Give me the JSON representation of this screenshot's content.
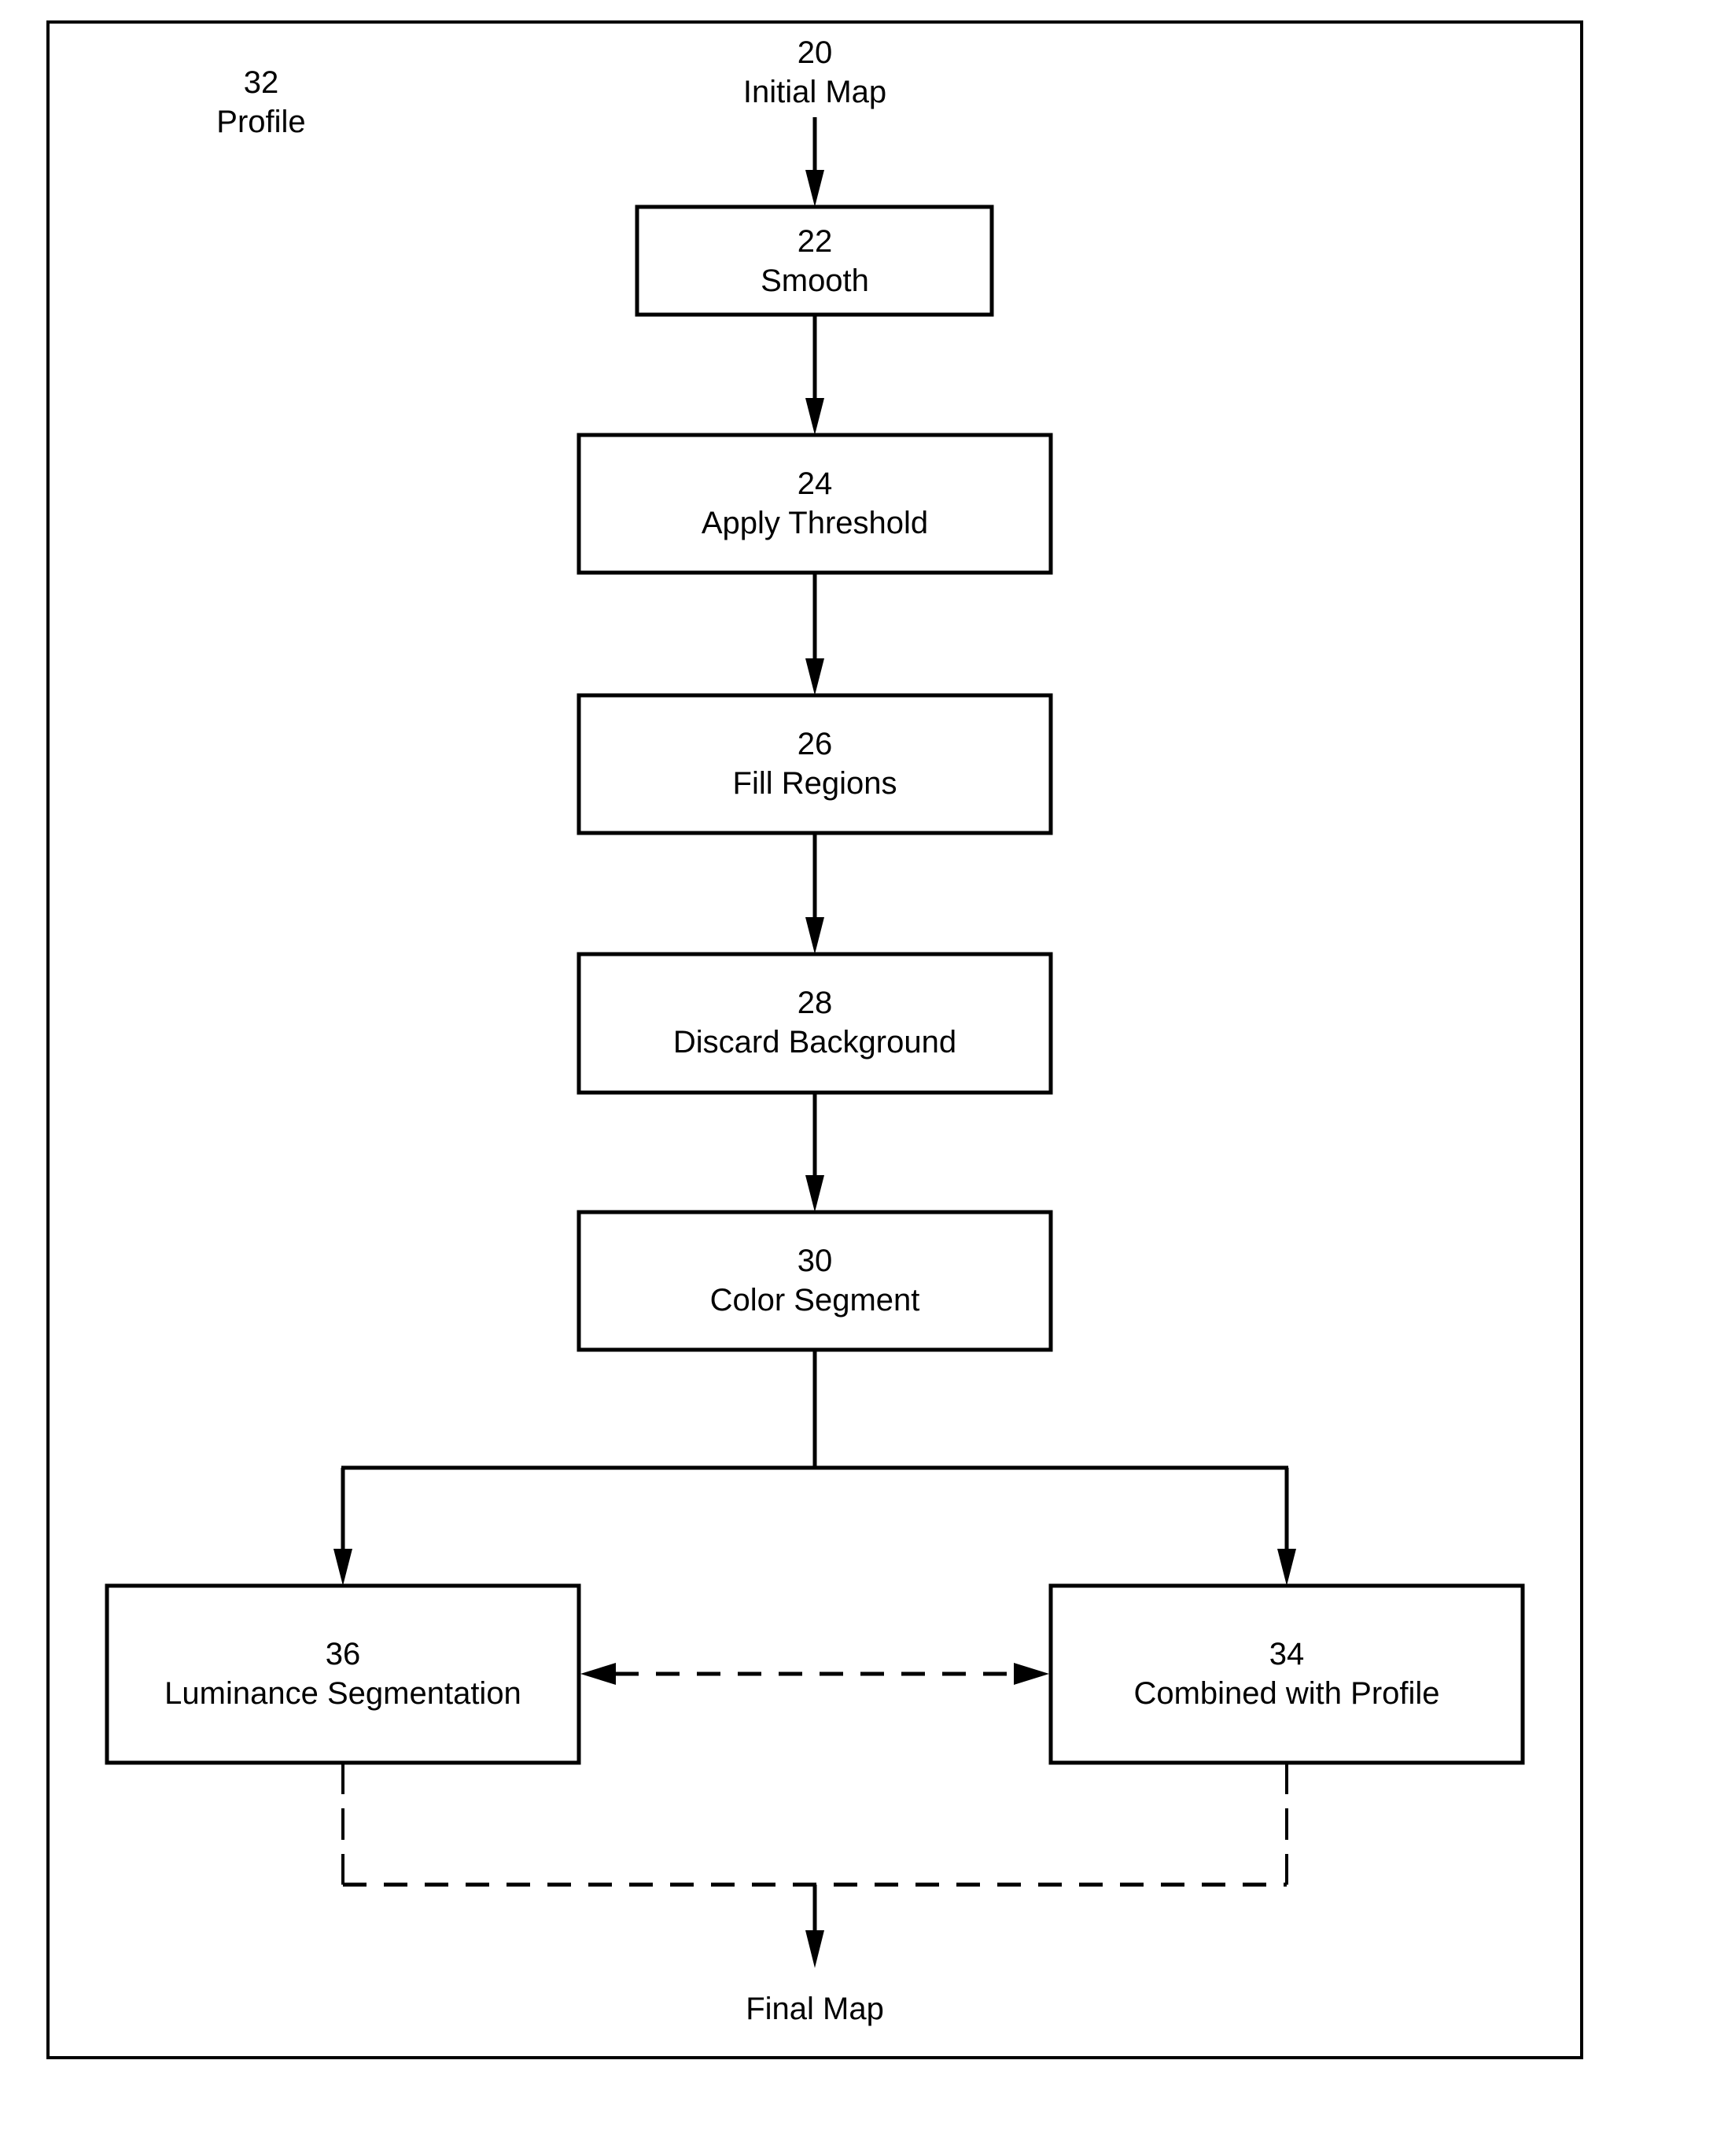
{
  "diagram": {
    "type": "flowchart",
    "colors": {
      "stroke": "#000000",
      "background": "#ffffff"
    },
    "labels": {
      "profile": {
        "number": "32",
        "text": "Profile"
      },
      "initial_map": {
        "number": "20",
        "text": "Initial Map"
      },
      "final_map": {
        "text": "Final Map"
      }
    },
    "nodes": [
      {
        "id": "smooth",
        "number": "22",
        "text": "Smooth"
      },
      {
        "id": "apply-threshold",
        "number": "24",
        "text": "Apply Threshold"
      },
      {
        "id": "fill-regions",
        "number": "26",
        "text": "Fill Regions"
      },
      {
        "id": "discard-background",
        "number": "28",
        "text": "Discard Background"
      },
      {
        "id": "color-segment",
        "number": "30",
        "text": "Color Segment"
      },
      {
        "id": "luminance-segmentation",
        "number": "36",
        "text": "Luminance Segmentation"
      },
      {
        "id": "combined-with-profile",
        "number": "34",
        "text": "Combined with Profile"
      }
    ],
    "edges": [
      {
        "from": "initial-map",
        "to": "smooth",
        "style": "solid"
      },
      {
        "from": "smooth",
        "to": "apply-threshold",
        "style": "solid"
      },
      {
        "from": "apply-threshold",
        "to": "fill-regions",
        "style": "solid"
      },
      {
        "from": "fill-regions",
        "to": "discard-background",
        "style": "solid"
      },
      {
        "from": "discard-background",
        "to": "color-segment",
        "style": "solid"
      },
      {
        "from": "color-segment",
        "to": "luminance-segmentation",
        "style": "solid"
      },
      {
        "from": "color-segment",
        "to": "combined-with-profile",
        "style": "solid"
      },
      {
        "from": "luminance-segmentation",
        "to": "combined-with-profile",
        "style": "dashed",
        "bidirectional": true
      },
      {
        "from": "luminance-segmentation",
        "to": "final-map",
        "style": "dashed"
      },
      {
        "from": "combined-with-profile",
        "to": "final-map",
        "style": "dashed"
      }
    ]
  }
}
